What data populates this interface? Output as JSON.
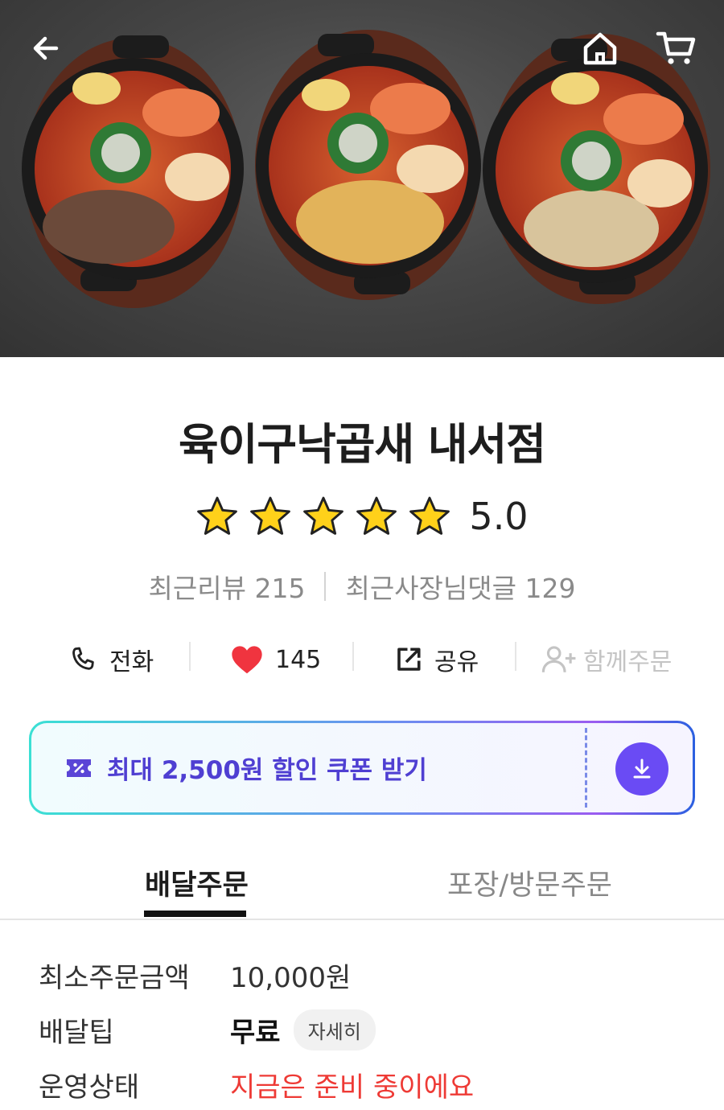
{
  "hero": {
    "image_alt": "food-photo"
  },
  "store": {
    "name": "육이구낙곱새 내서점",
    "rating": "5.0",
    "rating_stars": 5,
    "recent_reviews": "최근리뷰 215",
    "owner_replies": "최근사장님댓글 129"
  },
  "actions": {
    "call": "전화",
    "likes": "145",
    "share": "공유",
    "group_order": "함께주문"
  },
  "coupon": {
    "label": "최대 2,500원 할인 쿠폰 받기"
  },
  "tabs": [
    {
      "label": "배달주문",
      "active": true
    },
    {
      "label": "포장/방문주문",
      "active": false
    }
  ],
  "info": {
    "min_order_label": "최소주문금액",
    "min_order_value": "10,000원",
    "tip_label": "배달팁",
    "tip_value": "무료",
    "tip_detail": "자세히",
    "status_label": "운영상태",
    "status_value": "지금은 준비 중이에요"
  },
  "colors": {
    "accent": "#6a4bf4",
    "status": "#ee3a35",
    "heart": "#f0343f",
    "star": "#ffd11a"
  }
}
